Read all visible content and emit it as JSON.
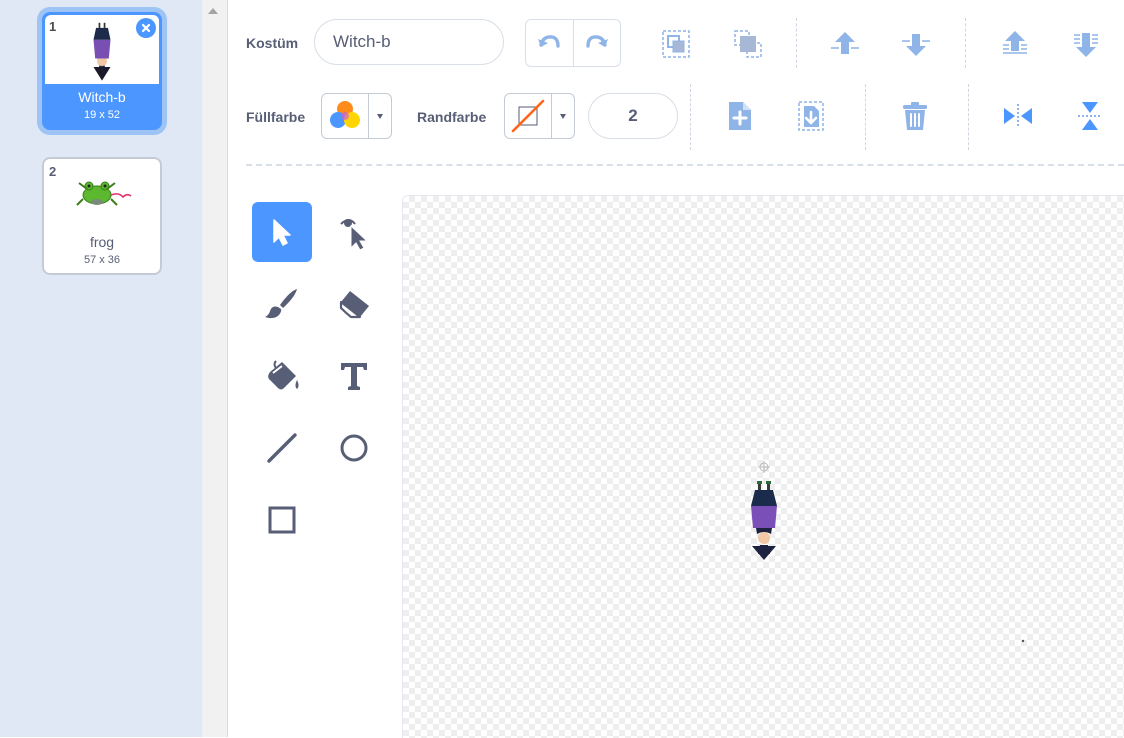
{
  "costumes": [
    {
      "number": "1",
      "name": "Witch-b",
      "size": "19 x 52",
      "selected": true
    },
    {
      "number": "2",
      "name": "frog",
      "size": "57 x 36",
      "selected": false
    }
  ],
  "toolbar": {
    "costume_label": "Kostüm",
    "costume_name_value": "Witch-b",
    "fill_label": "Füllfarbe",
    "outline_label": "Randfarbe",
    "outline_width_value": "2"
  },
  "icons": {
    "undo": "undo-icon",
    "redo": "redo-icon",
    "group": "group-icon",
    "ungroup": "ungroup-icon",
    "forward": "forward-icon",
    "backward": "backward-icon",
    "front": "front-icon",
    "back": "back-icon",
    "copy": "copy-icon",
    "paste": "paste-icon",
    "delete": "delete-icon",
    "flip_h": "flip-horizontal-icon",
    "flip_v": "flip-vertical-icon"
  },
  "tools": [
    "select",
    "reshape",
    "brush",
    "eraser",
    "fill",
    "text",
    "line",
    "circle",
    "rectangle"
  ],
  "colors": {
    "accent": "#4c97ff",
    "accent_light": "#9ec3f5",
    "text": "#575e75",
    "sidebar_bg": "#e0e8f5",
    "outline_none": "#ff661a"
  }
}
